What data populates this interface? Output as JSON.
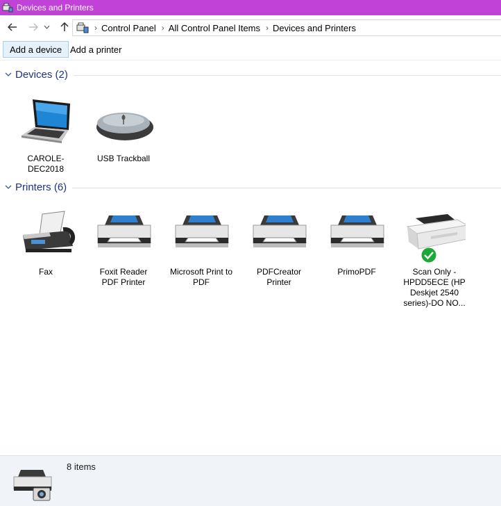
{
  "window": {
    "title": "Devices and Printers"
  },
  "nav": {
    "breadcrumbs": [
      "Control Panel",
      "All Control Panel Items",
      "Devices and Printers"
    ]
  },
  "toolbar": {
    "add_device": "Add a device",
    "add_printer": "Add a printer"
  },
  "groups": {
    "devices": {
      "title": "Devices (2)",
      "items": [
        {
          "label": "CAROLE-DEC2018",
          "icon": "laptop-icon"
        },
        {
          "label": "USB Trackball",
          "icon": "mouse-icon"
        }
      ]
    },
    "printers": {
      "title": "Printers (6)",
      "items": [
        {
          "label": "Fax",
          "icon": "fax-icon"
        },
        {
          "label": "Foxit Reader PDF Printer",
          "icon": "printer-icon"
        },
        {
          "label": "Microsoft Print to PDF",
          "icon": "printer-icon"
        },
        {
          "label": "PDFCreator Printer",
          "icon": "printer-icon"
        },
        {
          "label": "PrimoPDF",
          "icon": "printer-icon"
        },
        {
          "label": "Scan Only -HPDD5ECE (HP Deskjet 2540 series)-DO NO...",
          "icon": "hp-printer-icon",
          "status_badge": "default-check-icon"
        }
      ]
    }
  },
  "status": {
    "count": "8 items"
  },
  "colors": {
    "titlebar": "#c042d6",
    "group_header": "#1e3287",
    "status_bg": "#f0f4f9",
    "check": "#1fa83a"
  }
}
